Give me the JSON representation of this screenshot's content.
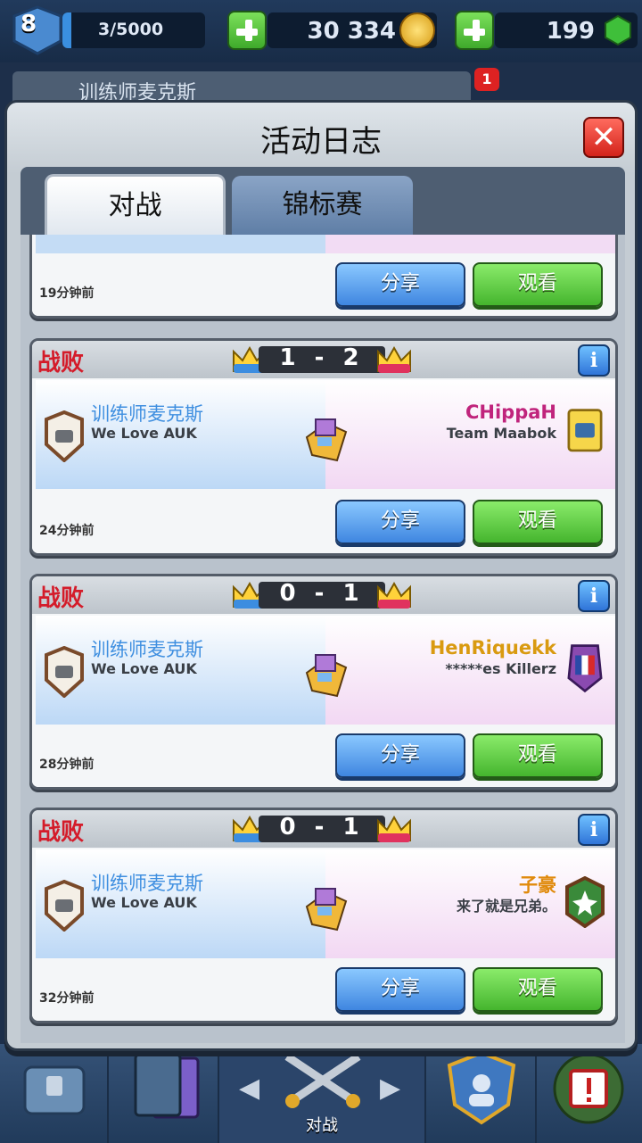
{
  "player": {
    "level": "8",
    "xp": "3/5000",
    "xp_fraction": 0.06
  },
  "currency": {
    "gold": "30 334",
    "gems": "199"
  },
  "profile": {
    "name": "训练师麦克斯",
    "notifications": "1"
  },
  "modal": {
    "title": "活动日志",
    "close_icon": "close-x-icon"
  },
  "tabs": [
    {
      "label": "对战",
      "active": true
    },
    {
      "label": "锦标赛",
      "active": false
    }
  ],
  "buttons": {
    "share": "分享",
    "watch": "观看"
  },
  "battles": [
    {
      "partial": true,
      "time": "19分钟前"
    },
    {
      "result": "战败",
      "score": "1 - 2",
      "player_name": "训练师麦克斯",
      "player_clan": "We Love AUK",
      "opponent_name": "CHippaH",
      "opponent_clan": "Team Maabok",
      "opponent_color": "#c0247c",
      "time": "24分钟前"
    },
    {
      "result": "战败",
      "score": "0 - 1",
      "player_name": "训练师麦克斯",
      "player_clan": "We Love AUK",
      "opponent_name": "HenRiquekk",
      "opponent_clan": "*****es Killerz",
      "opponent_color": "#d99a10",
      "time": "28分钟前"
    },
    {
      "result": "战败",
      "score": "0 - 1",
      "player_name": "训练师麦克斯",
      "player_clan": "We Love AUK",
      "opponent_name": "子豪",
      "opponent_clan": "来了就是兄弟。",
      "opponent_color": "#e08a0c",
      "time": "32分钟前"
    }
  ],
  "bottom_nav": {
    "active_label": "对战"
  }
}
